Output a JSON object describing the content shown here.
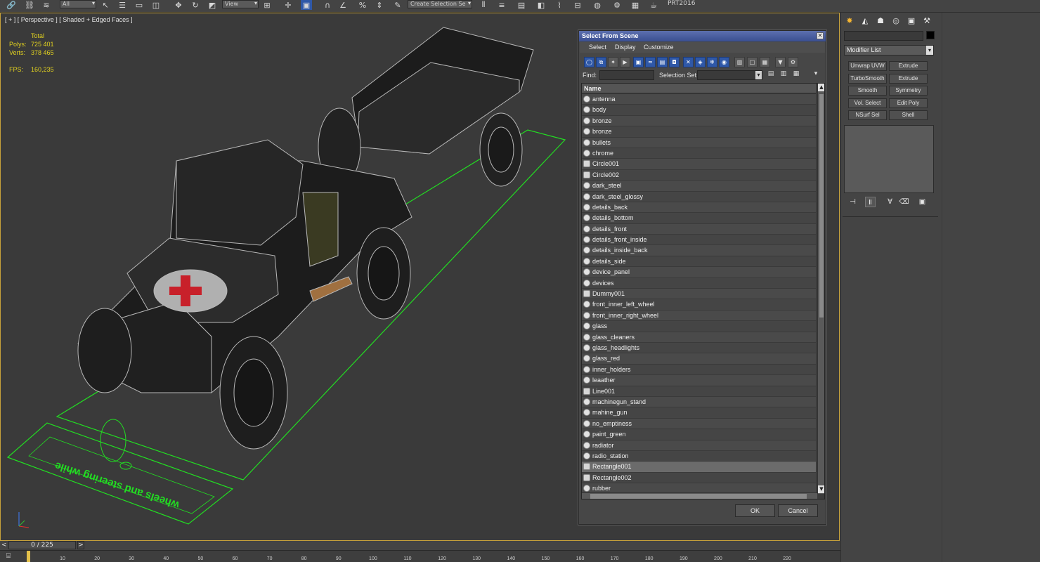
{
  "toolbar": {
    "combo_all": "All",
    "combo_view": "View",
    "combo_selection_set": "Create Selection Se",
    "app_label": "PRT2016"
  },
  "viewport": {
    "label": "[ + ] [ Perspective ] [ Shaded + Edged Faces ]",
    "stats": {
      "total_label": "Total",
      "polys_label": "Polys:",
      "polys_value": "725 401",
      "verts_label": "Verts:",
      "verts_value": "378 465",
      "fps_label": "FPS:",
      "fps_value": "160,235"
    },
    "annotation_text": "wheels and steering while",
    "accent_color": "#c8a23a",
    "helper_color": "#22dd22"
  },
  "dialog": {
    "title": "Select From Scene",
    "close": "×",
    "menu": [
      "Select",
      "Display",
      "Customize"
    ],
    "find_label": "Find:",
    "find_value": "",
    "selection_set_label": "Selection Set:",
    "column_name": "Name",
    "items": [
      {
        "label": "antenna",
        "icon": "geometry"
      },
      {
        "label": "body",
        "icon": "geometry"
      },
      {
        "label": "bronze",
        "icon": "geometry"
      },
      {
        "label": "bronze",
        "icon": "geometry"
      },
      {
        "label": "bullets",
        "icon": "geometry"
      },
      {
        "label": "chrome",
        "icon": "geometry"
      },
      {
        "label": "Circle001",
        "icon": "shape"
      },
      {
        "label": "Circle002",
        "icon": "shape"
      },
      {
        "label": "dark_steel",
        "icon": "geometry"
      },
      {
        "label": "dark_steel_glossy",
        "icon": "geometry"
      },
      {
        "label": "details_back",
        "icon": "geometry"
      },
      {
        "label": "details_bottom",
        "icon": "geometry"
      },
      {
        "label": "details_front",
        "icon": "geometry"
      },
      {
        "label": "details_front_inside",
        "icon": "geometry"
      },
      {
        "label": "details_inside_back",
        "icon": "geometry"
      },
      {
        "label": "details_side",
        "icon": "geometry"
      },
      {
        "label": "device_panel",
        "icon": "geometry"
      },
      {
        "label": "devices",
        "icon": "geometry"
      },
      {
        "label": "Dummy001",
        "icon": "helper"
      },
      {
        "label": "front_inner_left_wheel",
        "icon": "geometry"
      },
      {
        "label": "front_inner_right_wheel",
        "icon": "geometry"
      },
      {
        "label": "glass",
        "icon": "geometry"
      },
      {
        "label": "glass_cleaners",
        "icon": "geometry"
      },
      {
        "label": "glass_headlights",
        "icon": "geometry"
      },
      {
        "label": "glass_red",
        "icon": "geometry"
      },
      {
        "label": "inner_holders",
        "icon": "geometry"
      },
      {
        "label": "leaather",
        "icon": "geometry"
      },
      {
        "label": "Line001",
        "icon": "shape"
      },
      {
        "label": "machinegun_stand",
        "icon": "geometry"
      },
      {
        "label": "mahine_gun",
        "icon": "geometry"
      },
      {
        "label": "no_emptiness",
        "icon": "geometry"
      },
      {
        "label": "paint_green",
        "icon": "geometry"
      },
      {
        "label": "radiator",
        "icon": "geometry"
      },
      {
        "label": "radio_station",
        "icon": "geometry"
      },
      {
        "label": "Rectangle001",
        "icon": "shape",
        "selected": true
      },
      {
        "label": "Rectangle002",
        "icon": "shape"
      },
      {
        "label": "rubber",
        "icon": "geometry"
      }
    ],
    "ok_label": "OK",
    "cancel_label": "Cancel"
  },
  "command_panel": {
    "modifier_list": "Modifier List",
    "buttons": [
      [
        "Unwrap UVW",
        "Extrude"
      ],
      [
        "TurboSmooth",
        "Extrude"
      ],
      [
        "Smooth",
        "Symmetry"
      ],
      [
        "Vol. Select",
        "Edit Poly"
      ],
      [
        "NSurf Sel",
        "Shell"
      ]
    ],
    "object_color": "#000000",
    "active_tab_color": "#f5b531"
  },
  "timeline": {
    "frame_display": "0 / 225",
    "ticks": [
      "10",
      "20",
      "30",
      "40",
      "50",
      "60",
      "70",
      "80",
      "90",
      "100",
      "110",
      "120",
      "130",
      "140",
      "150",
      "160",
      "170",
      "180",
      "190",
      "200",
      "210",
      "220"
    ]
  }
}
